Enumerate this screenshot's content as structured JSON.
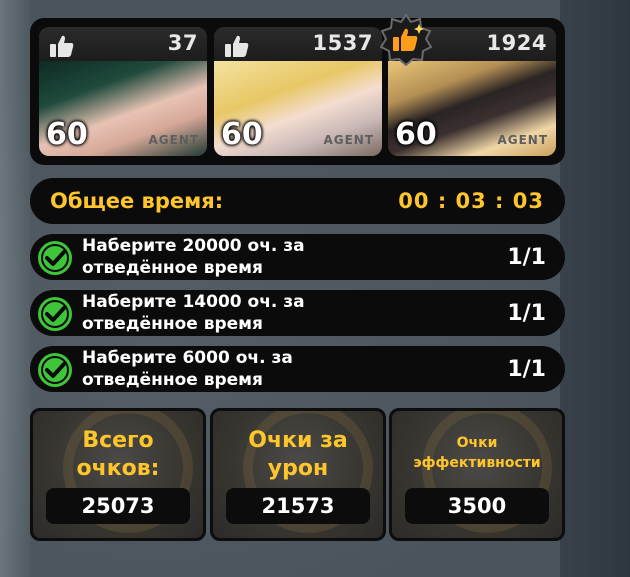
{
  "team": {
    "members": [
      {
        "likes": "37",
        "level": "60",
        "tag": "AGENT"
      },
      {
        "likes": "1537",
        "level": "60",
        "tag": "AGENT"
      },
      {
        "likes": "1924",
        "level": "60",
        "tag": "AGENT"
      }
    ]
  },
  "time": {
    "label": "Общее время:",
    "value": "00 : 03 : 03"
  },
  "tasks": [
    {
      "line1": "Наберите 20000 оч. за",
      "line2": "отведённое время",
      "progress": "1/1"
    },
    {
      "line1": "Наберите 14000 оч. за",
      "line2": "отведённое время",
      "progress": "1/1"
    },
    {
      "line1": "Наберите 6000 оч. за",
      "line2": "отведённое время",
      "progress": "1/1"
    }
  ],
  "scores": [
    {
      "line1": "Всего",
      "line2": "очков:",
      "value": "25073"
    },
    {
      "line1": "Очки за",
      "line2": "урон",
      "value": "21573"
    },
    {
      "line1": "Очки",
      "line2": "эффективности",
      "value": "3500"
    }
  ],
  "colors": {
    "accent": "#ffc62c",
    "check": "#3ec53a",
    "panel": "#0b0b0b"
  },
  "icons": [
    "thumbs-up-icon",
    "checkmark-icon",
    "mvp-badge-icon"
  ]
}
